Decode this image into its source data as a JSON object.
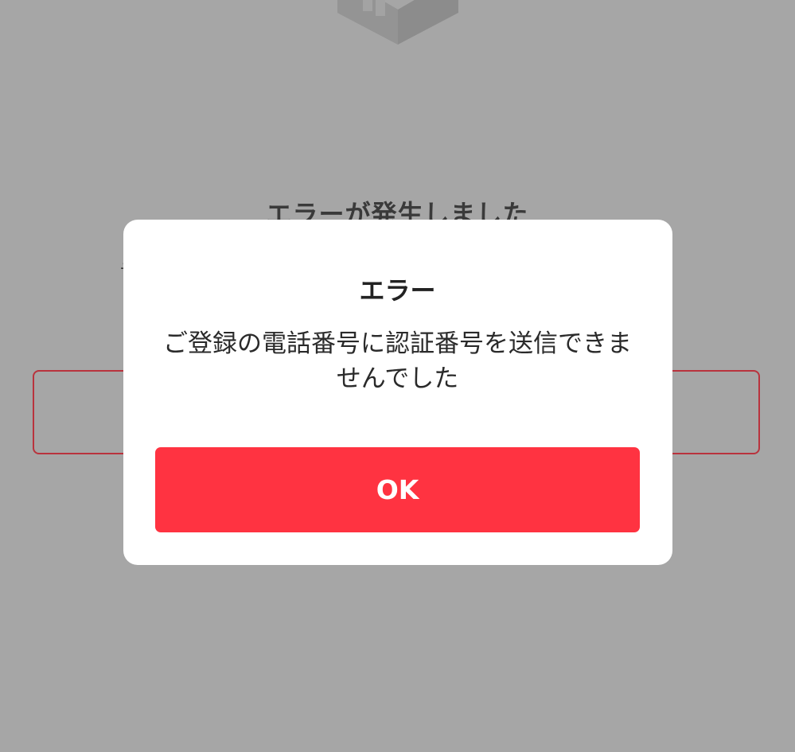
{
  "background": {
    "heading": "エラーが発生しました",
    "sub_left_fragment": "テ",
    "sub_right_fragment": "、",
    "icon": "box-icon"
  },
  "dialog": {
    "title": "エラー",
    "message": "ご登録の電話番号に認証番号を送信できませんでした",
    "ok_label": "OK"
  },
  "colors": {
    "overlay": "#a6a6a6",
    "accent": "#ff3341",
    "outline": "#b9333d"
  }
}
